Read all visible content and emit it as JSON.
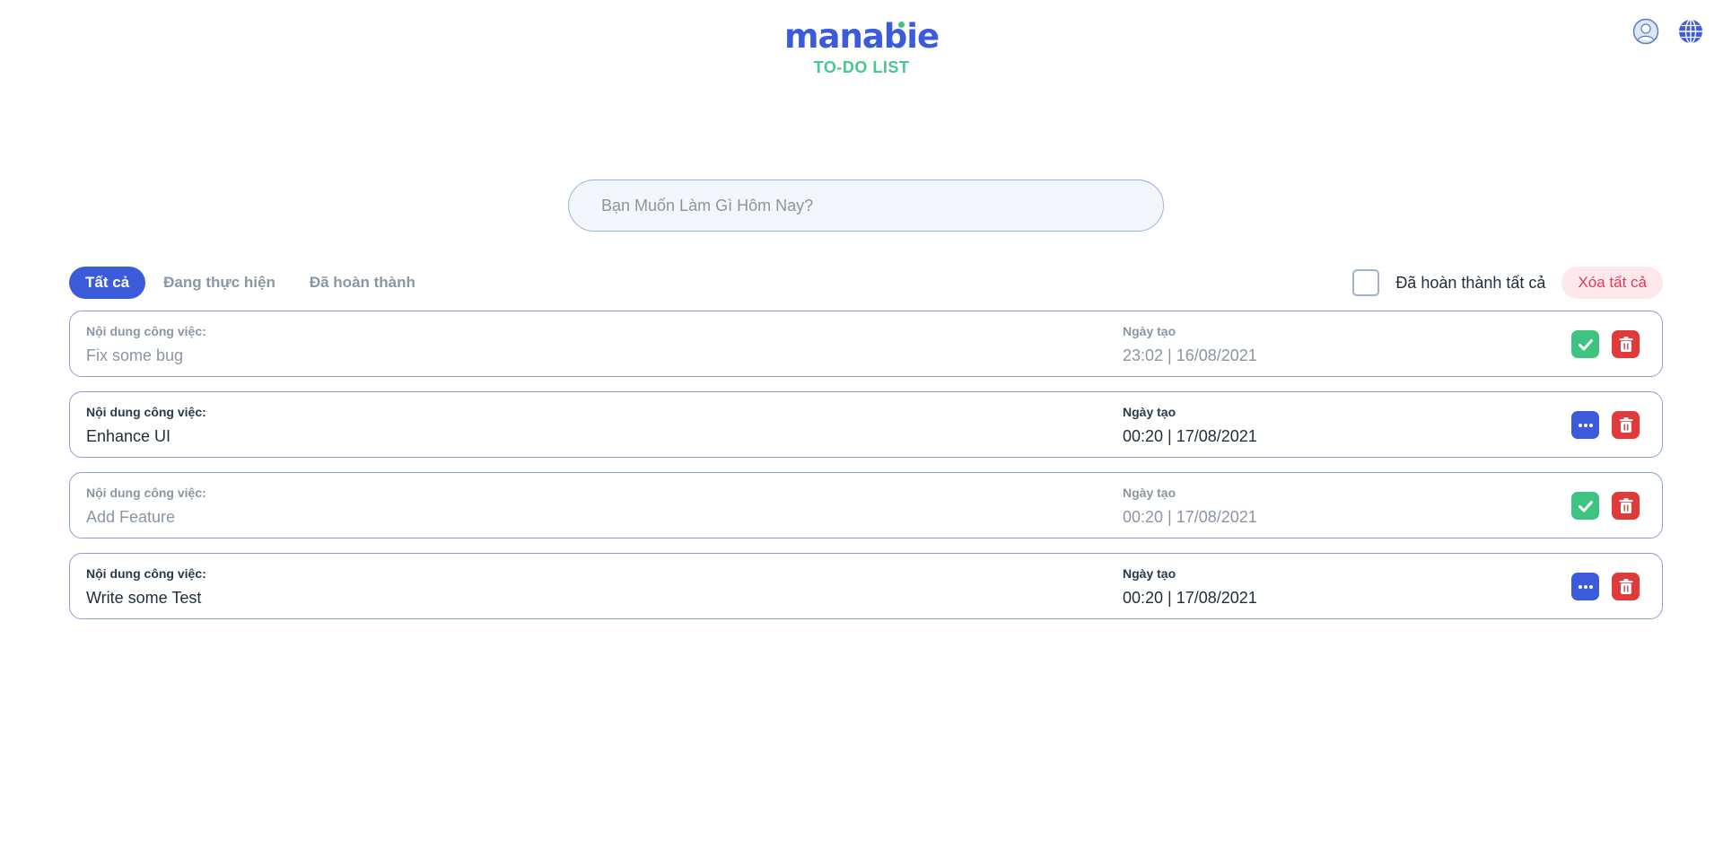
{
  "app": {
    "logo_text": "manabie",
    "subtitle": "TO-DO LIST"
  },
  "header_icons": {
    "profile_icon": "user-avatar-icon",
    "language_icon": "globe-icon"
  },
  "search": {
    "placeholder": "Bạn Muốn Làm Gì Hôm Nay?",
    "value": ""
  },
  "tabs": [
    {
      "label": "Tất cả",
      "active": true
    },
    {
      "label": "Đang thực hiện",
      "active": false
    },
    {
      "label": "Đã hoàn thành",
      "active": false
    }
  ],
  "actions": {
    "complete_all_label": "Đã hoàn thành tất cả",
    "complete_all_checked": false,
    "clear_all_label": "Xóa tất cả"
  },
  "colors": {
    "primary": "#3b5bdb",
    "success": "#3fc380",
    "danger": "#e03b3b",
    "danger_soft": "#fde8ec"
  },
  "todos": [
    {
      "content_label": "Nội dung công việc:",
      "content": "Fix some bug",
      "date_label": "Ngày tạo",
      "date": "23:02 | 16/08/2021",
      "status": "completed"
    },
    {
      "content_label": "Nội dung công việc:",
      "content": "Enhance UI",
      "date_label": "Ngày tạo",
      "date": "00:20 | 17/08/2021",
      "status": "active"
    },
    {
      "content_label": "Nội dung công việc:",
      "content": "Add Feature",
      "date_label": "Ngày tạo",
      "date": "00:20 | 17/08/2021",
      "status": "completed"
    },
    {
      "content_label": "Nội dung công việc:",
      "content": "Write some Test",
      "date_label": "Ngày tạo",
      "date": "00:20 | 17/08/2021",
      "status": "active"
    }
  ]
}
